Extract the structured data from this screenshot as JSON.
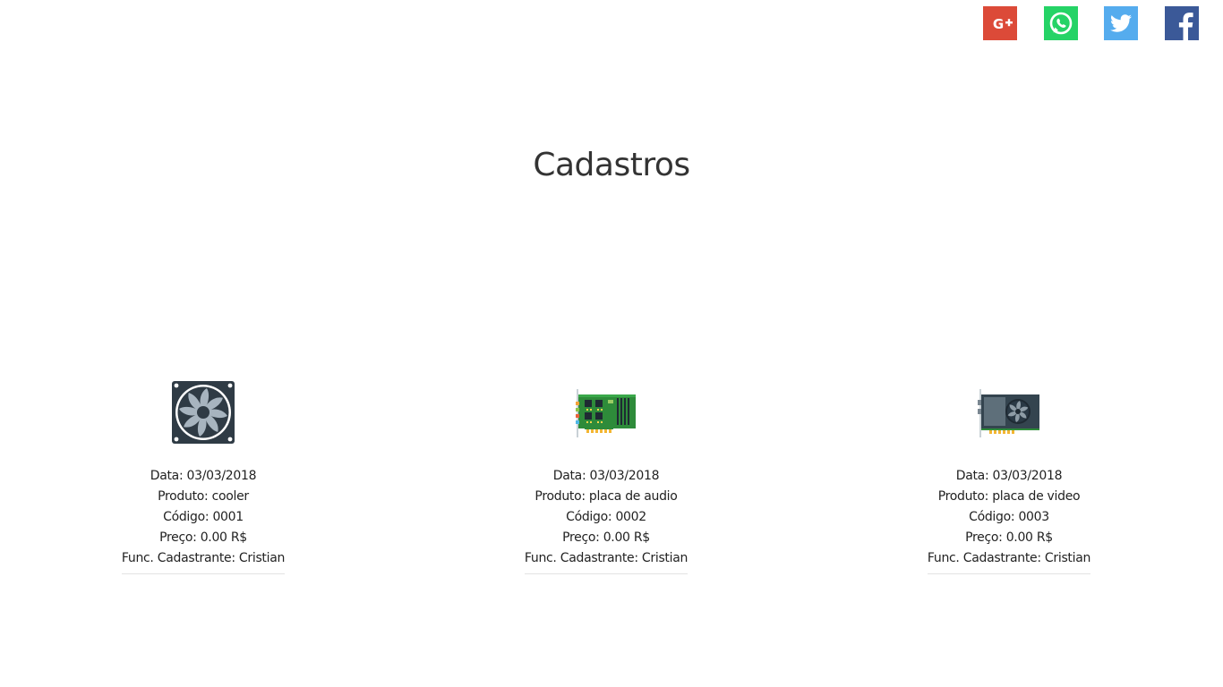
{
  "social": [
    {
      "name": "google-plus",
      "icon": "google-plus-icon",
      "color": "#dc4a38"
    },
    {
      "name": "whatsapp",
      "icon": "whatsapp-icon",
      "color": "#25d366"
    },
    {
      "name": "twitter",
      "icon": "twitter-icon",
      "color": "#55acee"
    },
    {
      "name": "facebook",
      "icon": "facebook-icon",
      "color": "#3b5998"
    }
  ],
  "page": {
    "title": "Cadastros"
  },
  "products": [
    {
      "icon": "cooler-fan-icon",
      "date": "Data: 03/03/2018",
      "product": "Produto: cooler",
      "code": "Código: 0001",
      "price": "Preço: 0.00 R$",
      "employee": "Func. Cadastrante: Cristian"
    },
    {
      "icon": "sound-card-icon",
      "date": "Data: 03/03/2018",
      "product": "Produto: placa de audio",
      "code": "Código: 0002",
      "price": "Preço: 0.00 R$",
      "employee": "Func. Cadastrante: Cristian"
    },
    {
      "icon": "video-card-icon",
      "date": "Data: 03/03/2018",
      "product": "Produto: placa de video",
      "code": "Código: 0003",
      "price": "Preço: 0.00 R$",
      "employee": "Func. Cadastrante: Cristian"
    }
  ]
}
